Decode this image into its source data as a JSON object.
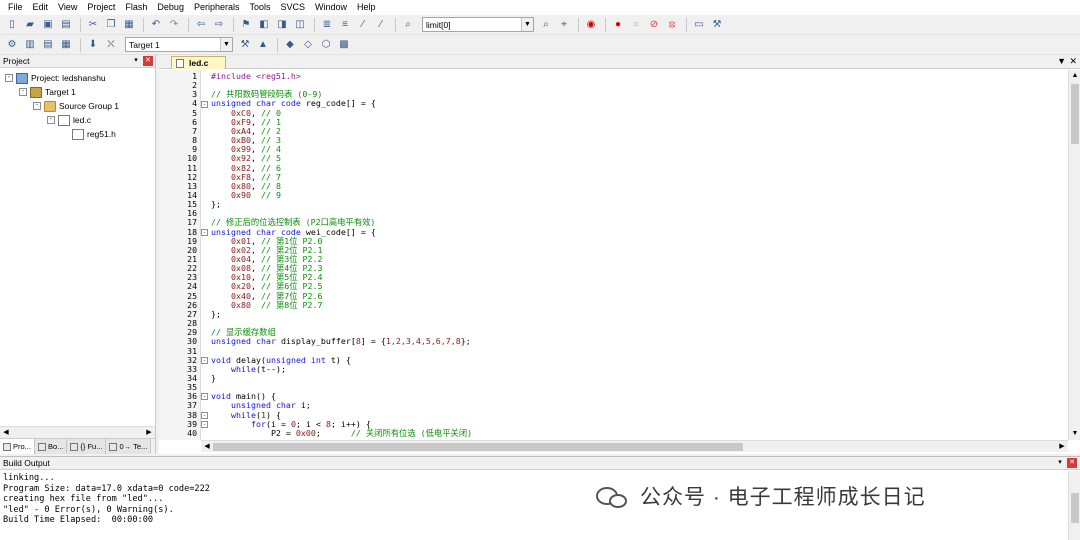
{
  "menu": [
    "File",
    "Edit",
    "View",
    "Project",
    "Flash",
    "Debug",
    "Peripherals",
    "Tools",
    "SVCS",
    "Window",
    "Help"
  ],
  "toolbar1": {
    "icons": [
      "new-file-icon",
      "open-file-icon",
      "save-icon",
      "save-all-icon",
      "cut-icon",
      "copy-icon",
      "paste-icon",
      "undo-icon",
      "redo-icon",
      "nav-back-icon",
      "nav-forward-icon",
      "bookmark-set-icon",
      "bookmark-prev-icon",
      "bookmark-next-icon",
      "bookmark-clear-icon",
      "indent-icon",
      "unindent-icon",
      "comment-icon",
      "uncomment-icon",
      "find-in-files-icon"
    ],
    "find_combo_value": "limit[0]",
    "icons_after": [
      "find-icon",
      "incremental-find-icon",
      "debug-start-icon",
      "breakpoint-insert-icon",
      "breakpoint-enable-icon",
      "breakpoint-disable-icon",
      "breakpoint-kill-icon",
      "window-layout-icon",
      "configure-icon"
    ]
  },
  "toolbar2": {
    "icons": [
      "translate-icon",
      "build-icon",
      "rebuild-icon",
      "batch-build-icon",
      "download-icon",
      "stop-build-icon"
    ],
    "target_combo_value": "Target 1",
    "icons_after": [
      "target-options-icon",
      "file-extensions-icon",
      "manage-components-icon",
      "select-pack-icon",
      "pack-installer-icon",
      "run-environment-icon"
    ]
  },
  "project_panel": {
    "title": "Project",
    "tree": [
      {
        "label": "Project: ledshanshu",
        "depth": 0,
        "icon": "project-icon",
        "expander": "-"
      },
      {
        "label": "Target 1",
        "depth": 1,
        "icon": "target-icon",
        "expander": "-"
      },
      {
        "label": "Source Group 1",
        "depth": 2,
        "icon": "folder-icon",
        "expander": "-"
      },
      {
        "label": "led.c",
        "depth": 3,
        "icon": "file-icon",
        "expander": "-"
      },
      {
        "label": "reg51.h",
        "depth": 4,
        "icon": "file-icon",
        "expander": ""
      }
    ],
    "bottom_tabs": [
      "Pro...",
      "Bo...",
      "{} Fu...",
      "0→ Te..."
    ]
  },
  "editor": {
    "tab_label": "led.c",
    "lines": [
      {
        "n": "1",
        "fold": "",
        "parts": [
          [
            "pp",
            "#include <reg51.h>"
          ]
        ]
      },
      {
        "n": "2",
        "fold": "",
        "parts": []
      },
      {
        "n": "3",
        "fold": "",
        "parts": [
          [
            "cm",
            "// 共阳数码管段码表 (0-9)"
          ]
        ]
      },
      {
        "n": "4",
        "fold": "-",
        "parts": [
          [
            "kw",
            "unsigned char code"
          ],
          [
            "",
            "reg_code[] = {"
          ]
        ]
      },
      {
        "n": "5",
        "fold": "",
        "parts": [
          [
            "",
            "    "
          ],
          [
            "nm",
            "0xC0"
          ],
          [
            "",
            ", "
          ],
          [
            "cm",
            "// 0"
          ]
        ]
      },
      {
        "n": "6",
        "fold": "",
        "parts": [
          [
            "",
            "    "
          ],
          [
            "nm",
            "0xF9"
          ],
          [
            "",
            ", "
          ],
          [
            "cm",
            "// 1"
          ]
        ]
      },
      {
        "n": "7",
        "fold": "",
        "parts": [
          [
            "",
            "    "
          ],
          [
            "nm",
            "0xA4"
          ],
          [
            "",
            ", "
          ],
          [
            "cm",
            "// 2"
          ]
        ]
      },
      {
        "n": "8",
        "fold": "",
        "parts": [
          [
            "",
            "    "
          ],
          [
            "nm",
            "0xB0"
          ],
          [
            "",
            ", "
          ],
          [
            "cm",
            "// 3"
          ]
        ]
      },
      {
        "n": "9",
        "fold": "",
        "parts": [
          [
            "",
            "    "
          ],
          [
            "nm",
            "0x99"
          ],
          [
            "",
            ", "
          ],
          [
            "cm",
            "// 4"
          ]
        ]
      },
      {
        "n": "10",
        "fold": "",
        "parts": [
          [
            "",
            "    "
          ],
          [
            "nm",
            "0x92"
          ],
          [
            "",
            ", "
          ],
          [
            "cm",
            "// 5"
          ]
        ]
      },
      {
        "n": "11",
        "fold": "",
        "parts": [
          [
            "",
            "    "
          ],
          [
            "nm",
            "0x82"
          ],
          [
            "",
            ", "
          ],
          [
            "cm",
            "// 6"
          ]
        ]
      },
      {
        "n": "12",
        "fold": "",
        "parts": [
          [
            "",
            "    "
          ],
          [
            "nm",
            "0xF8"
          ],
          [
            "",
            ", "
          ],
          [
            "cm",
            "// 7"
          ]
        ]
      },
      {
        "n": "13",
        "fold": "",
        "parts": [
          [
            "",
            "    "
          ],
          [
            "nm",
            "0x80"
          ],
          [
            "",
            ", "
          ],
          [
            "cm",
            "// 8"
          ]
        ]
      },
      {
        "n": "14",
        "fold": "",
        "parts": [
          [
            "",
            "    "
          ],
          [
            "nm",
            "0x90"
          ],
          [
            "",
            "  "
          ],
          [
            "cm",
            "// 9"
          ]
        ]
      },
      {
        "n": "15",
        "fold": "",
        "parts": [
          [
            "",
            "};"
          ]
        ]
      },
      {
        "n": "16",
        "fold": "",
        "parts": []
      },
      {
        "n": "17",
        "fold": "",
        "parts": [
          [
            "cm",
            "// 修正后的位选控制表 (P2口高电平有效)"
          ]
        ]
      },
      {
        "n": "18",
        "fold": "-",
        "parts": [
          [
            "kw",
            "unsigned char code"
          ],
          [
            "",
            "wei_code[] = {"
          ]
        ]
      },
      {
        "n": "19",
        "fold": "",
        "parts": [
          [
            "",
            "    "
          ],
          [
            "nm",
            "0x01"
          ],
          [
            "",
            ", "
          ],
          [
            "cm",
            "// 第1位 P2.0"
          ]
        ]
      },
      {
        "n": "20",
        "fold": "",
        "parts": [
          [
            "",
            "    "
          ],
          [
            "nm",
            "0x02"
          ],
          [
            "",
            ", "
          ],
          [
            "cm",
            "// 第2位 P2.1"
          ]
        ]
      },
      {
        "n": "21",
        "fold": "",
        "parts": [
          [
            "",
            "    "
          ],
          [
            "nm",
            "0x04"
          ],
          [
            "",
            ", "
          ],
          [
            "cm",
            "// 第3位 P2.2"
          ]
        ]
      },
      {
        "n": "22",
        "fold": "",
        "parts": [
          [
            "",
            "    "
          ],
          [
            "nm",
            "0x08"
          ],
          [
            "",
            ", "
          ],
          [
            "cm",
            "// 第4位 P2.3"
          ]
        ]
      },
      {
        "n": "23",
        "fold": "",
        "parts": [
          [
            "",
            "    "
          ],
          [
            "nm",
            "0x10"
          ],
          [
            "",
            ", "
          ],
          [
            "cm",
            "// 第5位 P2.4"
          ]
        ]
      },
      {
        "n": "24",
        "fold": "",
        "parts": [
          [
            "",
            "    "
          ],
          [
            "nm",
            "0x20"
          ],
          [
            "",
            ", "
          ],
          [
            "cm",
            "// 第6位 P2.5"
          ]
        ]
      },
      {
        "n": "25",
        "fold": "",
        "parts": [
          [
            "",
            "    "
          ],
          [
            "nm",
            "0x40"
          ],
          [
            "",
            ", "
          ],
          [
            "cm",
            "// 第7位 P2.6"
          ]
        ]
      },
      {
        "n": "26",
        "fold": "",
        "parts": [
          [
            "",
            "    "
          ],
          [
            "nm",
            "0x80"
          ],
          [
            "",
            "  "
          ],
          [
            "cm",
            "// 第8位 P2.7"
          ]
        ]
      },
      {
        "n": "27",
        "fold": "",
        "parts": [
          [
            "",
            "};"
          ]
        ]
      },
      {
        "n": "28",
        "fold": "",
        "parts": []
      },
      {
        "n": "29",
        "fold": "",
        "parts": [
          [
            "cm",
            "// 显示缓存数组"
          ]
        ]
      },
      {
        "n": "30",
        "fold": "",
        "parts": [
          [
            "kw",
            "unsigned char"
          ],
          [
            "",
            "display_buffer["
          ],
          [
            "nm",
            "8"
          ],
          [
            "",
            "] = {"
          ],
          [
            "nm",
            "1,2,3,4,5,6,7,8"
          ],
          [
            "",
            "};"
          ]
        ]
      },
      {
        "n": "31",
        "fold": "",
        "parts": []
      },
      {
        "n": "32",
        "fold": "-",
        "parts": [
          [
            "kw",
            "void"
          ],
          [
            "",
            "delay("
          ],
          [
            "kw",
            "unsigned int"
          ],
          [
            "",
            "t) {"
          ]
        ]
      },
      {
        "n": "33",
        "fold": "",
        "parts": [
          [
            "",
            "    "
          ],
          [
            "kw",
            "while"
          ],
          [
            "",
            "(t--);"
          ]
        ]
      },
      {
        "n": "34",
        "fold": "",
        "parts": [
          [
            "",
            "}"
          ]
        ]
      },
      {
        "n": "35",
        "fold": "",
        "parts": []
      },
      {
        "n": "36",
        "fold": "-",
        "parts": [
          [
            "kw",
            "void"
          ],
          [
            "",
            "main() {"
          ]
        ]
      },
      {
        "n": "37",
        "fold": "",
        "parts": [
          [
            "",
            "    "
          ],
          [
            "kw",
            "unsigned char"
          ],
          [
            "",
            "i;"
          ]
        ]
      },
      {
        "n": "38",
        "fold": "-",
        "parts": [
          [
            "",
            "    "
          ],
          [
            "kw",
            "while"
          ],
          [
            "",
            "("
          ],
          [
            "nm",
            "1"
          ],
          [
            "",
            ") {"
          ]
        ]
      },
      {
        "n": "39",
        "fold": "-",
        "parts": [
          [
            "",
            "        "
          ],
          [
            "kw",
            "for"
          ],
          [
            "",
            "(i = "
          ],
          [
            "nm",
            "0"
          ],
          [
            "",
            "; i < "
          ],
          [
            "nm",
            "8"
          ],
          [
            "",
            "; i++) {"
          ]
        ]
      },
      {
        "n": "40",
        "fold": "",
        "parts": [
          [
            "",
            "            P2 = "
          ],
          [
            "nm",
            "0x00"
          ],
          [
            "",
            ";      "
          ],
          [
            "cm",
            "// 关闭所有位选 (低电平关闭)"
          ]
        ]
      }
    ]
  },
  "build_output": {
    "title": "Build Output",
    "lines": [
      "linking...",
      "Program Size: data=17.0 xdata=0 code=222",
      "creating hex file from \"led\"...",
      "\"led\" - 0 Error(s), 0 Warning(s).",
      "Build Time Elapsed:  00:00:00"
    ]
  },
  "watermark": {
    "text": "公众号 · 电子工程师成长日记"
  },
  "colors": {
    "keyword": "#1414e0",
    "comment": "#0a8f0a",
    "number": "#8b1a1a",
    "preprocessor": "#8b1a8b"
  }
}
